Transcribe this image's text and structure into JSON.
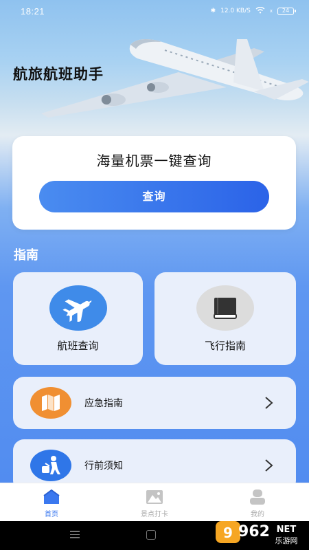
{
  "status_bar": {
    "time": "18:21",
    "network_speed": "12.0 KB/S",
    "battery": "24"
  },
  "hero": {
    "title": "航旅航班助手"
  },
  "search_card": {
    "title": "海量机票一键查询",
    "button_label": "查询"
  },
  "guide": {
    "section_title": "指南",
    "grid": [
      {
        "label": "航班查询",
        "icon": "airplane-icon",
        "icon_bg": "#3f8be9"
      },
      {
        "label": "飞行指南",
        "icon": "book-icon",
        "icon_bg": "#dcdcdc"
      }
    ],
    "list": [
      {
        "label": "应急指南",
        "icon": "map-icon",
        "icon_bg": "#f08f32"
      },
      {
        "label": "行前须知",
        "icon": "traveler-icon",
        "icon_bg": "#2f76e8"
      }
    ]
  },
  "tab_bar": {
    "tabs": [
      {
        "label": "首页",
        "icon": "home-icon",
        "active": true
      },
      {
        "label": "景点打卡",
        "icon": "mountain-icon",
        "active": false
      },
      {
        "label": "我的",
        "icon": "user-icon",
        "active": false
      }
    ]
  },
  "watermark": {
    "number": "962",
    "suffix": "NET",
    "text": "乐游网"
  },
  "colors": {
    "accent": "#3b78ef",
    "card_bg": "#e9effb"
  }
}
